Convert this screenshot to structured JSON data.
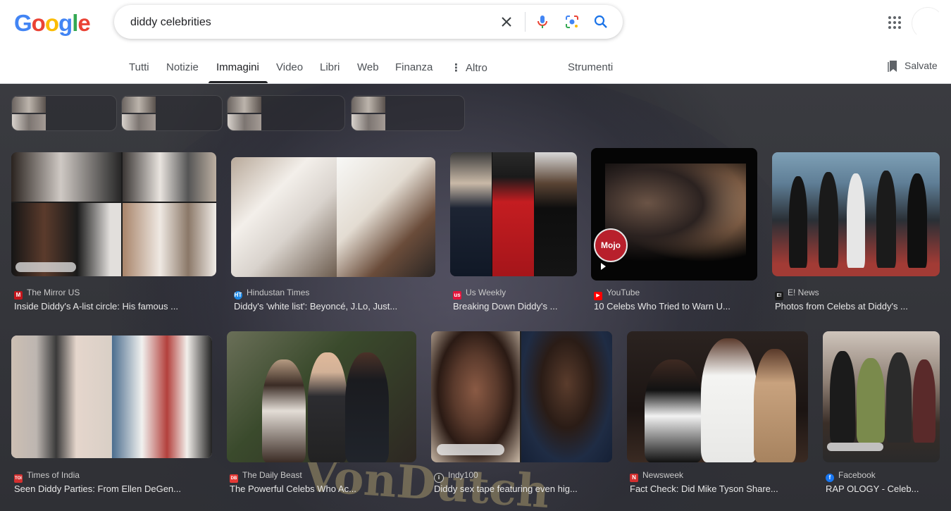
{
  "logo": "Google",
  "search": {
    "query": "diddy celebrities",
    "placeholder": ""
  },
  "tabs": [
    {
      "label": "Tutti"
    },
    {
      "label": "Notizie"
    },
    {
      "label": "Immagini"
    },
    {
      "label": "Video"
    },
    {
      "label": "Libri"
    },
    {
      "label": "Web"
    },
    {
      "label": "Finanza"
    },
    {
      "label": "Altro"
    },
    {
      "label": "Strumenti"
    }
  ],
  "saved_label": "Salvate",
  "icons": {
    "clear": "close-icon",
    "voice": "microphone-icon",
    "lens": "camera-lens-icon",
    "search": "search-icon",
    "apps": "apps-grid-icon",
    "saved": "bookmark-icon"
  },
  "colors": {
    "accent": "#1a73e8",
    "overlay_bg": "#2f3035",
    "text_light": "#e8e8e8",
    "source_text": "#c9c9c9"
  },
  "results_row1": [
    {
      "source": "The Mirror US",
      "title": "Inside Diddy's A-list circle: His famous ...",
      "favicon_color": "#c4161c",
      "favicon_letter": "M"
    },
    {
      "source": "Hindustan Times",
      "title": "Diddy's 'white list': Beyoncé, J.Lo, Just...",
      "favicon_color": "#1e88e5",
      "favicon_letter": "HT"
    },
    {
      "source": "Us Weekly",
      "title": "Breaking Down Diddy's ...",
      "favicon_color": "#e3143b",
      "favicon_letter": "us"
    },
    {
      "source": "YouTube",
      "title": "10 Celebs Who Tried to Warn U...",
      "favicon_color": "#ff0000",
      "favicon_letter": "▶"
    },
    {
      "source": "E! News",
      "title": "Photos from Celebs at Diddy's ...",
      "favicon_color": "#1a1a1a",
      "favicon_letter": "E!"
    }
  ],
  "results_row2": [
    {
      "source": "Times of India",
      "title": "Seen Diddy Parties: From Ellen DeGen...",
      "favicon_color": "#d32f2f",
      "favicon_letter": "TOI"
    },
    {
      "source": "The Daily Beast",
      "title": "The Powerful Celebs Who Ac...",
      "favicon_color": "#e53935",
      "favicon_letter": "DB"
    },
    {
      "source": "Indy100",
      "title": "Diddy sex tape featuring even hig...",
      "favicon_color": "#333333",
      "favicon_letter": "i"
    },
    {
      "source": "Newsweek",
      "title": "Fact Check: Did Mike Tyson Share...",
      "favicon_color": "#d32f2f",
      "favicon_letter": "N"
    },
    {
      "source": "Facebook",
      "title": "RAP OLOGY - Celeb...",
      "favicon_color": "#1877f2",
      "favicon_letter": "f"
    }
  ],
  "overlay_caption": "Mojo"
}
